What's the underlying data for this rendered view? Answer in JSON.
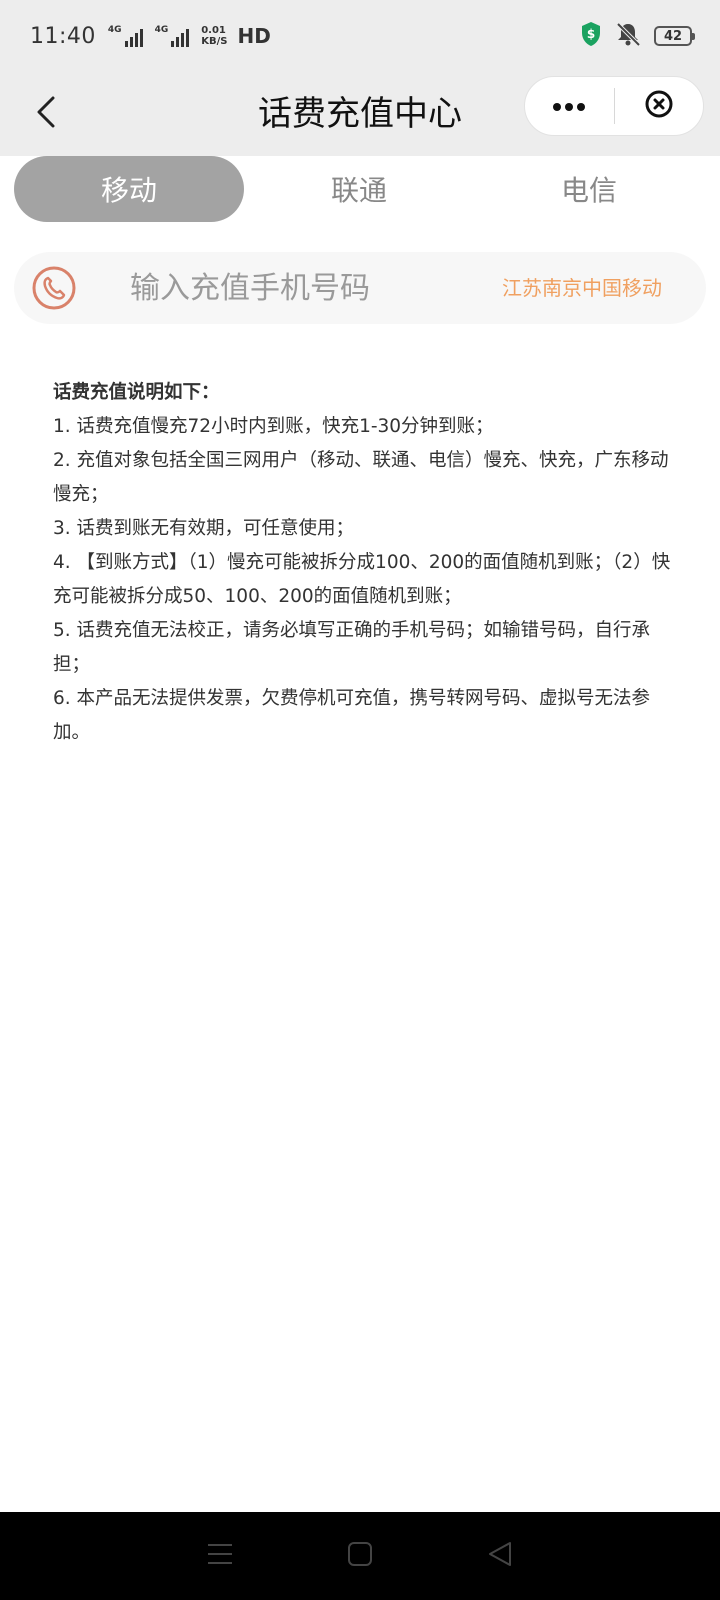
{
  "status_bar": {
    "time": "11:40",
    "signal1_tag": "4G",
    "signal2_tag": "4G",
    "net_speed_value": "0.01",
    "net_speed_unit": "KB/S",
    "hd_label": "HD",
    "battery_level": "42"
  },
  "nav": {
    "title": "话费充值中心"
  },
  "tabs": [
    {
      "label": "移动"
    },
    {
      "label": "联通"
    },
    {
      "label": "电信"
    }
  ],
  "phone": {
    "placeholder": "输入充值手机号码",
    "carrier": "江苏南京中国移动"
  },
  "instructions": {
    "heading": "话费充值说明如下：",
    "items": [
      "1. 话费充值慢充72小时内到账，快充1-30分钟到账；",
      "2. 充值对象包括全国三网用户（移动、联通、电信）慢充、快充，广东移动慢充；",
      "3. 话费到账无有效期，可任意使用；",
      "4. 【到账方式】（1）慢充可能被拆分成100、200的面值随机到账；（2）快充可能被拆分成50、100、200的面值随机到账；",
      "5. 话费充值无法校正，请务必填写正确的手机号码；如输错号码，自行承担；",
      "6. 本产品无法提供发票，欠费停机可充值，携号转网号码、虚拟号无法参加。"
    ]
  },
  "colors": {
    "accent_orange": "#f0a060",
    "tab_active_bg": "#a3a3a3",
    "phone_icon": "#d9826a",
    "shield_green": "#1aa260"
  },
  "icons": {
    "back": "back-arrow-icon",
    "more": "more-dots-icon",
    "close": "close-circle-icon",
    "phone": "phone-icon",
    "shield": "shield-dollar-icon",
    "mute": "bell-mute-icon"
  }
}
